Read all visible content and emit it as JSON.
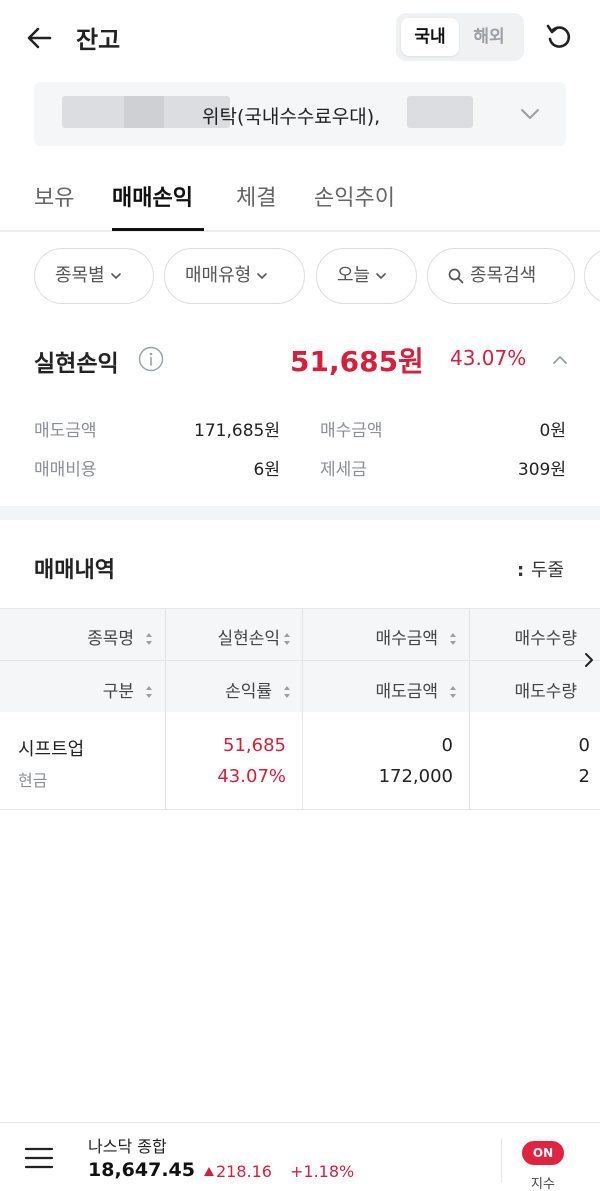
{
  "header": {
    "title": "잔고",
    "segment": {
      "domestic": "국내",
      "overseas": "해외"
    }
  },
  "account": {
    "label": "위탁(국내수수료우대),"
  },
  "tabs": [
    "보유",
    "매매손익",
    "체결",
    "손익추이"
  ],
  "filters": [
    "종목별",
    "매매유형",
    "오늘",
    "종목검색"
  ],
  "realized": {
    "label": "실현손익",
    "amount": "51,685원",
    "rate": "43.07%",
    "sell_amount_label": "매도금액",
    "sell_amount": "171,685원",
    "buy_amount_label": "매수금액",
    "buy_amount": "0원",
    "cost_label": "매매비용",
    "cost": "6원",
    "tax_label": "제세금",
    "tax": "309원"
  },
  "history": {
    "title": "매매내역",
    "view_toggle": "두줄",
    "columns_row1": [
      "종목명",
      "실현손익",
      "매수금액",
      "매수수량"
    ],
    "columns_row2": [
      "구분",
      "손익률",
      "매도금액",
      "매도수량"
    ],
    "rows": [
      {
        "name": "시프트업",
        "type": "현금",
        "pl": "51,685",
        "pl_rate": "43.07%",
        "buy_amount": "0",
        "sell_amount": "172,000",
        "buy_qty": "0",
        "sell_qty": "2"
      }
    ]
  },
  "bottom": {
    "index_name": "나스닥 종합",
    "index_value": "18,647.45",
    "index_change": "218.16",
    "index_pct": "+1.18%",
    "toggle": "ON",
    "toggle_label": "지수"
  },
  "colors": {
    "accent_red": "#d61f3a",
    "badge_red": "#e0233e"
  }
}
